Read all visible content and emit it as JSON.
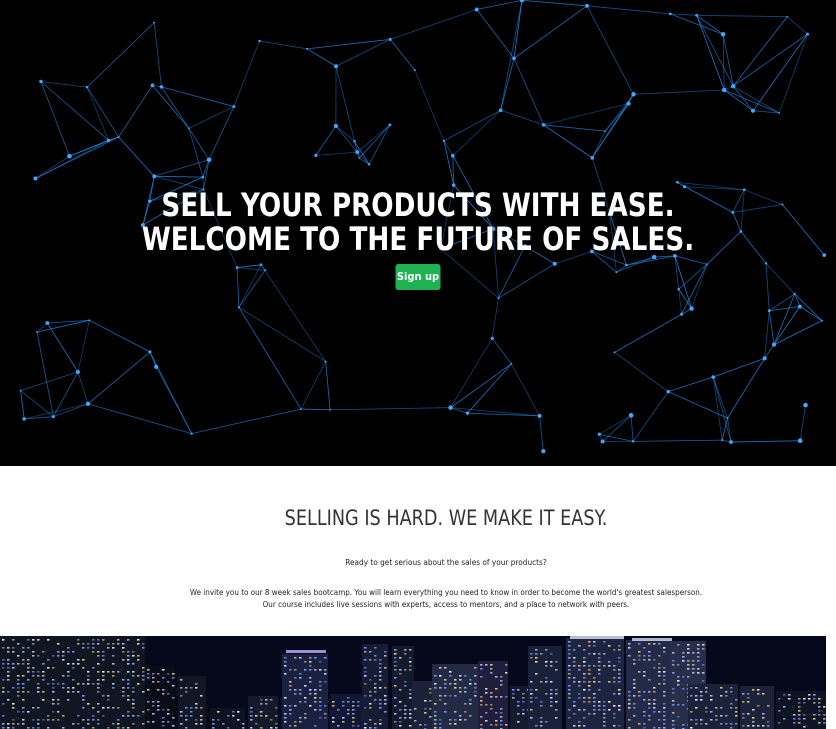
{
  "hero": {
    "title_line1": "SELL YOUR PRODUCTS WITH EASE.",
    "title_line2": "WELCOME TO THE FUTURE OF SALES.",
    "signup_label": "Sign up"
  },
  "intro": {
    "heading": "SELLING IS HARD. WE MAKE IT EASY.",
    "question": "Ready to get serious about the sales of your products?",
    "body_line1": "We invite you to our 8 week sales bootcamp. You will learn everything you need to know in order to become the world's greatest salesperson.",
    "body_line2": "Our course includes live sessions with experts, access to mentors, and a place to network with peers."
  },
  "colors": {
    "hero_background": "#000000",
    "network_line": "#1e88e5",
    "network_node": "#42a5f5",
    "signup_button": "#1fb254",
    "heading_text": "#333333",
    "body_text": "#222222"
  },
  "images": {
    "hero_background": "network-constellation-graphic",
    "city_banner": "city-skyline-at-night-photo"
  }
}
